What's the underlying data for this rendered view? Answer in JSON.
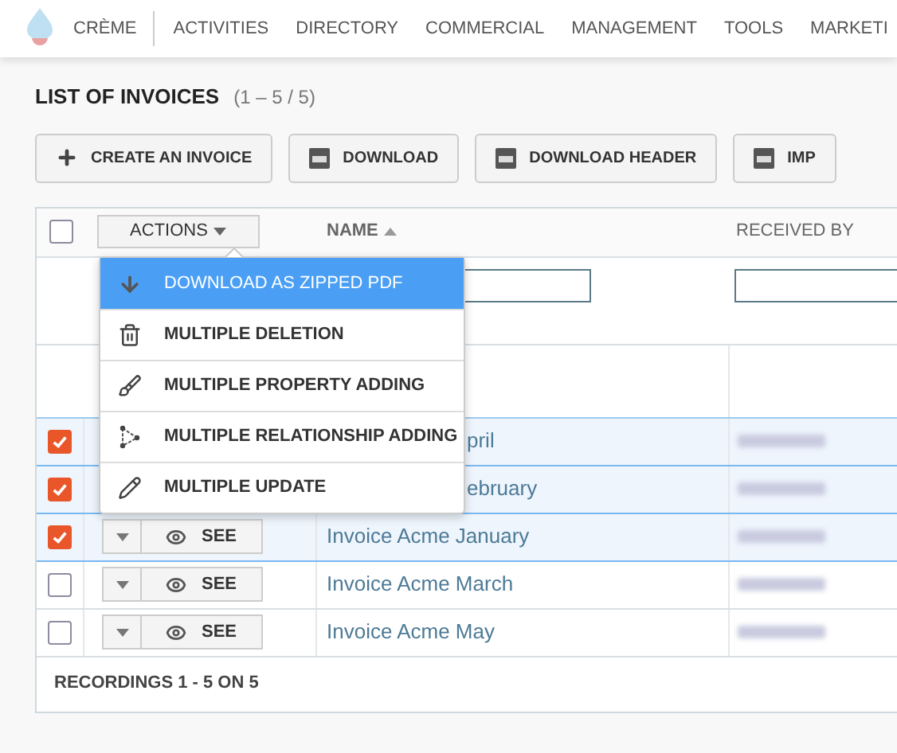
{
  "nav": {
    "items": [
      {
        "label": "CRÈME"
      },
      {
        "label": "ACTIVITIES"
      },
      {
        "label": "DIRECTORY"
      },
      {
        "label": "COMMERCIAL"
      },
      {
        "label": "MANAGEMENT"
      },
      {
        "label": "TOOLS"
      },
      {
        "label": "MARKETI"
      }
    ]
  },
  "page_title": "LIST OF INVOICES",
  "count": "(1 – 5 / 5)",
  "buttons": [
    {
      "label": "CREATE AN INVOICE",
      "kind": "add"
    },
    {
      "label": "DOWNLOAD",
      "kind": "csv"
    },
    {
      "label": "DOWNLOAD HEADER",
      "kind": "csv"
    },
    {
      "label": "IMP",
      "kind": "csv"
    }
  ],
  "table": {
    "select_all": {
      "checked": false
    },
    "actions_button": "ACTIONS",
    "columns": [
      {
        "label": "NAME",
        "sorted": true
      },
      {
        "label": "RECEIVED BY",
        "sorted": false
      }
    ],
    "rows": [
      {
        "checked": true,
        "name": "pril",
        "covered": true
      },
      {
        "checked": true,
        "name": "ebruary",
        "covered": true
      },
      {
        "checked": true,
        "name": "Invoice Acme January",
        "covered": false,
        "see": "SEE"
      },
      {
        "checked": false,
        "name": "Invoice Acme March",
        "covered": false,
        "see": "SEE"
      },
      {
        "checked": false,
        "name": "Invoice Acme May",
        "covered": false,
        "see": "SEE"
      }
    ],
    "footer": "RECORDINGS 1 - 5 ON 5"
  },
  "actions_menu": {
    "items": [
      {
        "label": "DOWNLOAD AS ZIPPED PDF",
        "kind": "download",
        "selected": true
      },
      {
        "label": "MULTIPLE DELETION",
        "kind": "delete",
        "selected": false
      },
      {
        "label": "MULTIPLE PROPERTY ADDING",
        "kind": "property",
        "selected": false
      },
      {
        "label": "MULTIPLE RELATIONSHIP ADDING",
        "kind": "relation",
        "selected": false
      },
      {
        "label": "MULTIPLE UPDATE",
        "kind": "update",
        "selected": false
      }
    ]
  }
}
